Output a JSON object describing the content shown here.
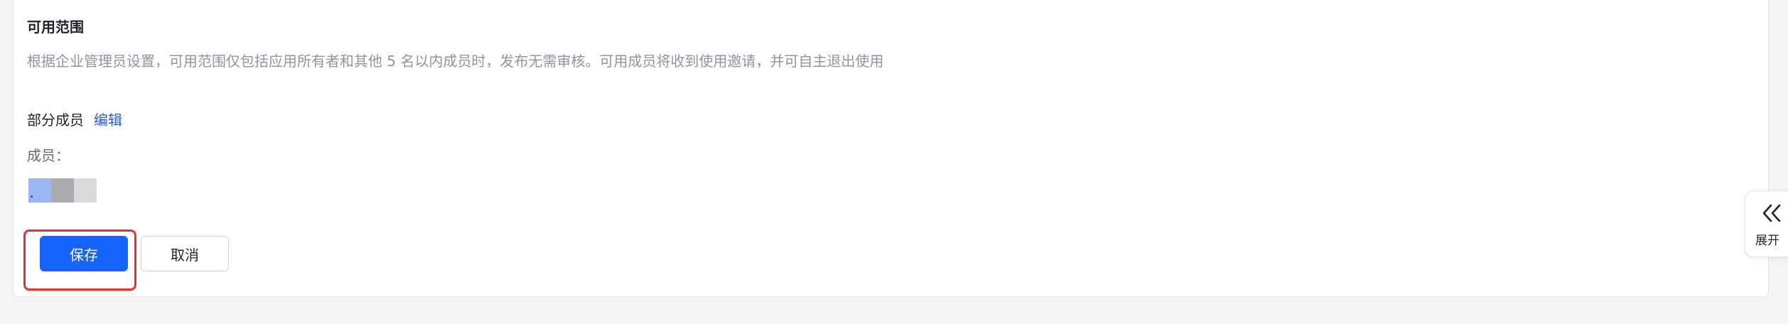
{
  "scope": {
    "title": "可用范围",
    "description": "根据企业管理员设置，可用范围仅包括应用所有者和其他 5 名以内成员时，发布无需审核。可用成员将收到使用邀请，并可自主退出使用",
    "selection": "部分成员",
    "edit_label": "编辑",
    "members_label": "成员："
  },
  "actions": {
    "save_label": "保存",
    "cancel_label": "取消"
  },
  "side_panel": {
    "expand_icon": "double-chevron-left-icon",
    "expand_label": "展开"
  },
  "colors": {
    "primary": "#1664ff",
    "link": "#245bdb",
    "highlight": "#e5352b",
    "background": "#f3f4f5"
  }
}
